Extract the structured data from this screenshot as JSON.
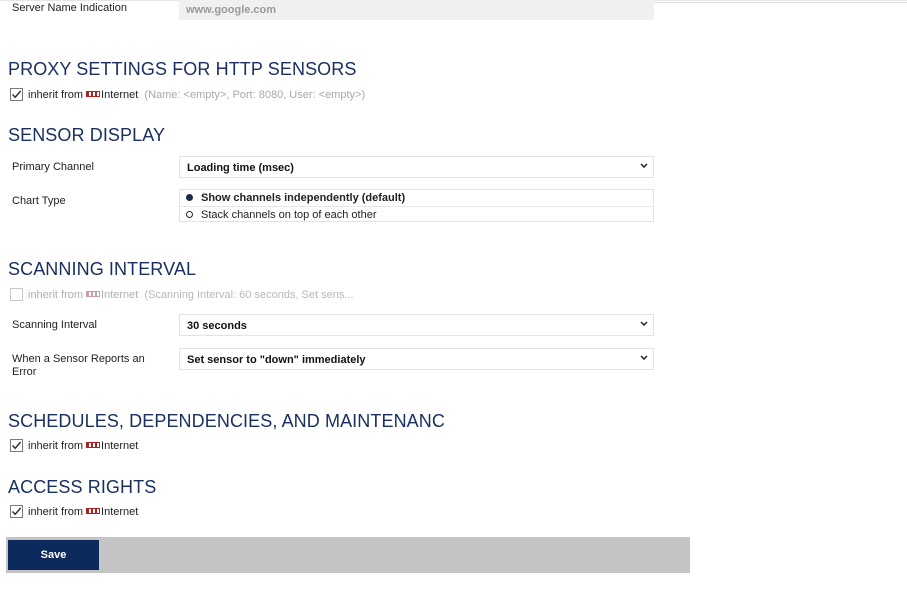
{
  "sni": {
    "label": "Server Name Indication",
    "value": "www.google.com"
  },
  "proxy": {
    "title": "PROXY SETTINGS FOR HTTP SENSORS",
    "inherit_label": "inherit from",
    "device": "Internet",
    "details": "(Name: <empty>, Port: 8080, User: <empty>)",
    "checked": true
  },
  "sensor_display": {
    "title": "SENSOR DISPLAY",
    "primary_channel_label": "Primary Channel",
    "primary_channel_value": "Loading time (msec)",
    "chart_type_label": "Chart Type",
    "chart_type_options": [
      "Show channels independently (default)",
      "Stack channels on top of each other"
    ],
    "chart_type_selected": 0
  },
  "scanning": {
    "title": "SCANNING INTERVAL",
    "inherit_label": "inherit from",
    "device": "Internet",
    "details": "(Scanning Interval: 60 seconds, Set sens...",
    "checked": false,
    "interval_label": "Scanning Interval",
    "interval_value": "30 seconds",
    "error_label": "When a Sensor Reports an Error",
    "error_value": "Set sensor to \"down\" immediately"
  },
  "schedules": {
    "title": "SCHEDULES, DEPENDENCIES, AND MAINTENANC",
    "inherit_label": "inherit from",
    "device": "Internet",
    "checked": true
  },
  "access": {
    "title": "ACCESS RIGHTS",
    "inherit_label": "inherit from",
    "device": "Internet",
    "checked": true
  },
  "save_label": "Save",
  "colors": {
    "heading": "#1a3060",
    "save_button": "#0c2a5c",
    "save_bar": "#c4c4c4",
    "device_icon": "#b02020"
  }
}
